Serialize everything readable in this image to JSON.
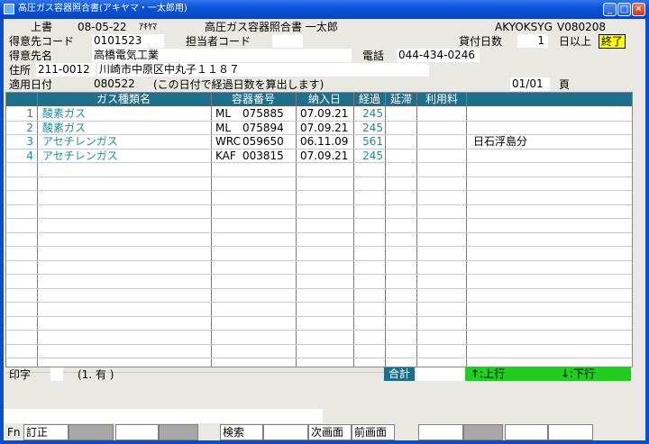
{
  "window": {
    "title": "高圧ガス容器照合書(アキヤマ・一太郎用)"
  },
  "header": {
    "mode": "上書",
    "date": "08-05-22",
    "user_kana": "ｱｷﾔﾏ",
    "screen_title": "高圧ガス容器照合書 一太郎",
    "program_id": "AKYOKSYG",
    "version": "V080208"
  },
  "form": {
    "customer_code_label": "得意先コード",
    "customer_code": "0101523",
    "staff_code_label": "担当者コード",
    "staff_code": "",
    "loan_days_label": "貸付日数",
    "loan_days": "1",
    "loan_days_suffix": "日以上",
    "end_button": "終了",
    "customer_name_label": "得意先名",
    "customer_name": "高橋電気工業",
    "phone_label": "電話",
    "phone": "044-434-0246",
    "address_label": "住所",
    "postal": "211-0012",
    "address": "川崎市中原区中丸子１１８７",
    "apply_date_label": "適用日付",
    "apply_date": "080522",
    "apply_note": "(この日付で経過日数を算出します)",
    "page": "01/01",
    "page_label": "頁"
  },
  "table": {
    "columns": [
      "ガス種類名",
      "容器番号",
      "納入日",
      "経過",
      "延滞",
      "利用料"
    ],
    "rows": [
      {
        "no": "1",
        "gas": "酸素ガス",
        "prefix": "ML",
        "container": "075885",
        "delivered": "07.09.21",
        "elapsed": "245",
        "overdue": "",
        "fee": "",
        "note": ""
      },
      {
        "no": "2",
        "gas": "酸素ガス",
        "prefix": "ML",
        "container": "075894",
        "delivered": "07.09.21",
        "elapsed": "245",
        "overdue": "",
        "fee": "",
        "note": ""
      },
      {
        "no": "3",
        "gas": "アセチレンガス",
        "prefix": "WRC",
        "container": "059650",
        "delivered": "06.11.09",
        "elapsed": "561",
        "overdue": "",
        "fee": "",
        "note": "日石浮島分"
      },
      {
        "no": "4",
        "gas": "アセチレンガス",
        "prefix": "KAF",
        "container": "003815",
        "delivered": "07.09.21",
        "elapsed": "245",
        "overdue": "",
        "fee": "",
        "note": ""
      }
    ]
  },
  "footer": {
    "print_label": "印字",
    "print_value": "",
    "print_hint": "(1. 有 )",
    "total_label": "合計",
    "total_value": "",
    "prev_row": "↑:上行",
    "next_row": "↓:下行"
  },
  "fkeys": {
    "fn_label": "Fn",
    "f1": "訂正",
    "f2": "",
    "f3": "",
    "f4": "",
    "f5": "検索",
    "f6": "",
    "f7": "次画面",
    "f8": "前画面",
    "f9": "",
    "f10": "",
    "f11": "",
    "f12": ""
  },
  "colors": {
    "title_bar": "#0a52d8",
    "grid_header": "#1f6f8b",
    "teal_text": "#1f8a9a",
    "end_button": "#ffff00",
    "row_nav": "#22cc22"
  }
}
